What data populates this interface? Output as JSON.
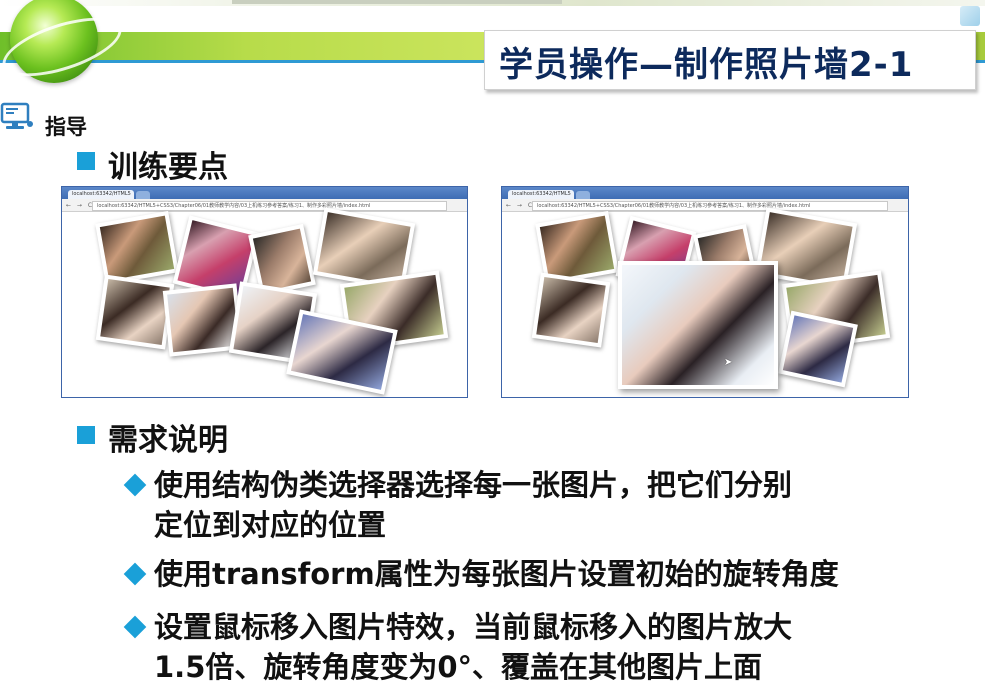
{
  "slide": {
    "title": "学员操作—制作照片墙2-1",
    "guide_label": "指导",
    "section1": "训练要点",
    "section2": "需求说明",
    "requirements": [
      "使用结构伪类选择器选择每一张图片，把它们分别",
      "定位到对应的位置",
      "使用transform属性为每张图片设置初始的旋转角度",
      "设置鼠标移入图片特效，当前鼠标移入的图片放大",
      "1.5倍、旋转角度变为0°、覆盖在其他图片上面"
    ]
  },
  "screenshots": {
    "tab_text": "localhost:63342/HTML5",
    "url_text": "localhost:63342/HTML5+CSS3/Chapter06/01教师教学内容/03上机练习参考答案/练习1、制作多彩照片墙/index.html",
    "nav_glyphs": "← → C",
    "left": {
      "rotations_deg": [
        -10,
        14,
        -12,
        10,
        8,
        -6,
        9,
        -8,
        12,
        6
      ]
    },
    "right": {
      "hovered_photo_scale": 1.5,
      "hovered_photo_rotation_deg": 0
    }
  },
  "colors": {
    "title_text": "#0d2a5c",
    "bullet": "#1aa0d8",
    "band_green": "#b7dc4a",
    "band_blue_line": "#2f9ad3",
    "browser_frame": "#3d64a8"
  },
  "icons": [
    "globe-icon",
    "monitor-guide-icon",
    "square-bullet-icon",
    "diamond-bullet-icon",
    "mouse-cursor-icon"
  ]
}
